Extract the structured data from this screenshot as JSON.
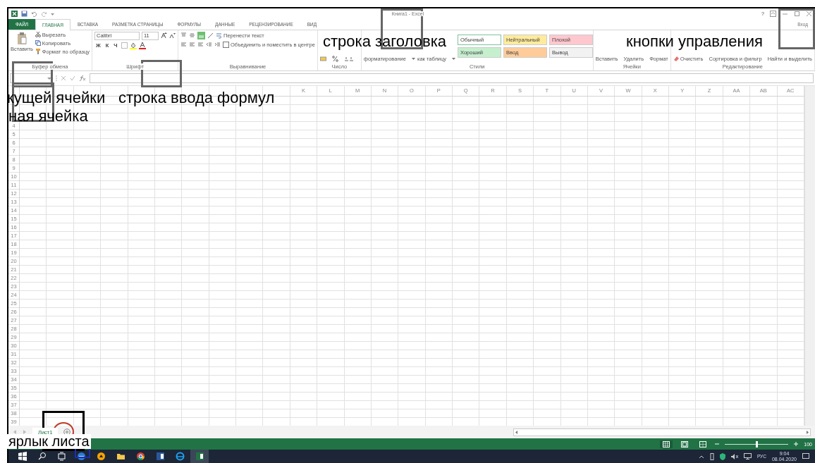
{
  "title_bar": {
    "title": "Книга1 - Excel",
    "help": "?"
  },
  "tabs": [
    {
      "label": "ФАЙЛ",
      "kind": "file",
      "selected": false
    },
    {
      "label": "ГЛАВНАЯ",
      "kind": "tab",
      "selected": true
    },
    {
      "label": "ВСТАВКА",
      "kind": "tab",
      "selected": false
    },
    {
      "label": "РАЗМЕТКА СТРАНИЦЫ",
      "kind": "tab",
      "selected": false
    },
    {
      "label": "ФОРМУЛЫ",
      "kind": "tab",
      "selected": false
    },
    {
      "label": "ДАННЫЕ",
      "kind": "tab",
      "selected": false
    },
    {
      "label": "РЕЦЕНЗИРОВАНИЕ",
      "kind": "tab",
      "selected": false
    },
    {
      "label": "ВИД",
      "kind": "tab",
      "selected": false
    }
  ],
  "sign_in": "Вход",
  "ribbon": [
    {
      "kind": "clipboard",
      "label": "Буфер обмена",
      "big": "Вставить",
      "items": [
        "Вырезать",
        "Копировать",
        "Формат по образцу"
      ]
    },
    {
      "kind": "font",
      "label": "Шрифт",
      "font": "Calibri",
      "size": "11",
      "format_buttons": [
        "Ж",
        "К",
        "Ч"
      ]
    },
    {
      "kind": "align",
      "label": "Выравнивание",
      "items": [
        "Перенести текст",
        "Объединить и поместить в центре"
      ]
    },
    {
      "kind": "number",
      "label": "Число"
    },
    {
      "kind": "styles",
      "label": "Стили",
      "buttons": [
        "форматирование",
        "как таблицу"
      ],
      "styles": [
        {
          "label": "Обычный",
          "color": "#ffffff"
        },
        {
          "label": "Нейтральный",
          "color": "#ffeb9c"
        },
        {
          "label": "Плохой",
          "color": "#ffc7ce"
        },
        {
          "label": "Хороший",
          "color": "#c6efce"
        },
        {
          "label": "Ввод",
          "color": "#ffcc99"
        },
        {
          "label": "Вывод",
          "color": "#f2f2f2"
        }
      ]
    },
    {
      "kind": "cells",
      "label": "Ячейки",
      "buttons": [
        "Вставить",
        "Удалить",
        "Формат"
      ]
    },
    {
      "kind": "editing",
      "label": "Редактирование",
      "buttons": [
        "Очистить",
        "Сортировка и фильтр",
        "Найти и выделить"
      ]
    }
  ],
  "columns": [
    "K",
    "L",
    "M",
    "N",
    "O",
    "P",
    "Q",
    "R",
    "S",
    "T",
    "U",
    "V",
    "W",
    "X",
    "Y",
    "Z",
    "AA",
    "AB",
    "AC"
  ],
  "rows": [
    "4",
    "5",
    "6",
    "7",
    "8",
    "9",
    "10",
    "11",
    "12",
    "13",
    "14",
    "15",
    "16",
    "17",
    "18",
    "19",
    "20",
    "21",
    "22",
    "23",
    "24",
    "25",
    "26",
    "27",
    "28",
    "29",
    "30",
    "31",
    "32",
    "33",
    "34",
    "35",
    "36",
    "37",
    "38",
    "39"
  ],
  "sheets": [
    {
      "label": "Лист1",
      "selected": true
    }
  ],
  "status_bar": {
    "views": [
      {
        "kind": "normal",
        "selected": true
      },
      {
        "kind": "layout",
        "selected": false
      },
      {
        "kind": "pagebreak",
        "selected": false
      }
    ],
    "zoom": {
      "level": 0.5,
      "reading": "100"
    }
  },
  "taskbar": {
    "apps": [
      {
        "kind": "start",
        "selected": false
      },
      {
        "kind": "search",
        "selected": false
      },
      {
        "kind": "taskview",
        "selected": false
      },
      {
        "kind": "edge",
        "selected": false
      },
      {
        "kind": "round",
        "selected": false
      },
      {
        "kind": "folder",
        "selected": false
      },
      {
        "kind": "chrome",
        "selected": false
      },
      {
        "kind": "word",
        "selected": false
      },
      {
        "kind": "ie",
        "selected": false
      },
      {
        "kind": "excel",
        "selected": true
      }
    ],
    "language": "РУС",
    "time": "9:04",
    "date": "08.04.2020"
  },
  "annotations": [
    {
      "text": "строка заголовка"
    },
    {
      "text": "кнопки управления"
    },
    {
      "text": "кущей ячейки"
    },
    {
      "text": "строка ввода формул"
    },
    {
      "text": "ная ячейка"
    },
    {
      "text": "ярлык листа"
    }
  ]
}
